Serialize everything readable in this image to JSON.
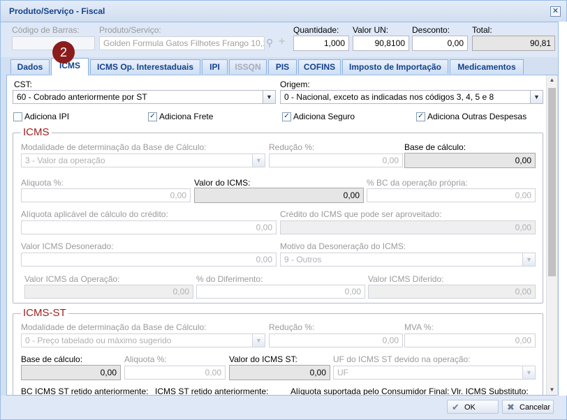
{
  "window": {
    "title": "Produto/Serviço - Fiscal",
    "close_icon": "close-icon"
  },
  "header": {
    "barcode_label": "Código de Barras:",
    "barcode_value": "",
    "product_label": "Produto/Serviço:",
    "product_value": "Golden Formula Gatos Filhotes Frango 10,1",
    "quantity_label": "Quantidade:",
    "quantity_value": "1,000",
    "unit_value_label": "Valor UN:",
    "unit_value": "90,8100",
    "discount_label": "Desconto:",
    "discount_value": "0,00",
    "total_label": "Total:",
    "total_value": "90,81"
  },
  "badge": {
    "number": "2",
    "color": "#8b1c1c"
  },
  "tabs": [
    {
      "label": "Dados"
    },
    {
      "label": "ICMS"
    },
    {
      "label": "ICMS Op. Interestaduais"
    },
    {
      "label": "IPI"
    },
    {
      "label": "ISSQN"
    },
    {
      "label": "PIS"
    },
    {
      "label": "COFINS"
    },
    {
      "label": "Imposto de Importação"
    },
    {
      "label": "Medicamentos"
    }
  ],
  "general": {
    "cst_label": "CST:",
    "cst_value": "60 - Cobrado anteriormente por ST",
    "origem_label": "Origem:",
    "origem_value": "0 - Nacional, exceto as indicadas nos códigos 3, 4, 5 e 8",
    "checks": [
      {
        "label": "Adiciona IPI",
        "checked": false
      },
      {
        "label": "Adiciona Frete",
        "checked": true
      },
      {
        "label": "Adiciona Seguro",
        "checked": true
      },
      {
        "label": "Adiciona Outras Despesas",
        "checked": true
      }
    ]
  },
  "icms": {
    "legend": "ICMS",
    "modalidade_label": "Modalidade de determinação da Base de Cálculo:",
    "modalidade_value": "3 - Valor da operação",
    "reducao_label": "Redução %:",
    "reducao_value": "0,00",
    "base_label": "Base de cálculo:",
    "base_value": "0,00",
    "aliquota_label": "Aliquota %:",
    "aliquota_value": "0,00",
    "valor_label": "Valor do ICMS:",
    "valor_value": "0,00",
    "bc_op_label": "% BC da operação própria:",
    "bc_op_value": "0,00",
    "aliq_credito_label": "Alíquota aplicável de cálculo do crédito:",
    "aliq_credito_value": "0,00",
    "credito_label": "Crédito do ICMS que pode ser aproveitado:",
    "credito_value": "0,00",
    "desonerado_label": "Valor ICMS Desonerado:",
    "desonerado_value": "0,00",
    "motivo_label": "Motivo da Desoneração do ICMS:",
    "motivo_value": "9 - Outros",
    "operacao_label": "Valor ICMS da Operação:",
    "operacao_value": "0,00",
    "diferimento_label": "% do Diferimento:",
    "diferimento_value": "0,00",
    "diferido_label": "Valor ICMS Diferido:",
    "diferido_value": "0,00"
  },
  "icms_st": {
    "legend": "ICMS-ST",
    "modalidade_label": "Modalidade de determinação da Base de Cálculo:",
    "modalidade_value": "0 - Preço tabelado ou máximo sugerido",
    "reducao_label": "Redução %:",
    "reducao_value": "0,00",
    "mva_label": "MVA %:",
    "mva_value": "0,00",
    "base_label": "Base de cálculo:",
    "base_value": "0,00",
    "aliquota_label": "Aliquota %:",
    "aliquota_value": "0,00",
    "valor_label": "Valor do ICMS ST:",
    "valor_value": "0,00",
    "uf_label": "UF do ICMS ST devido na operação:",
    "uf_value": "UF",
    "bc_retido_label": "BC ICMS ST retido anteriormente:",
    "retido_label": "ICMS ST retido anteriormente:",
    "aliq_consumidor_label": "Alíquota suportada pelo Consumidor Final:",
    "substituto_label": "Vlr. ICMS Substituto:"
  },
  "footer": {
    "ok_label": "OK",
    "cancel_label": "Cancelar"
  }
}
